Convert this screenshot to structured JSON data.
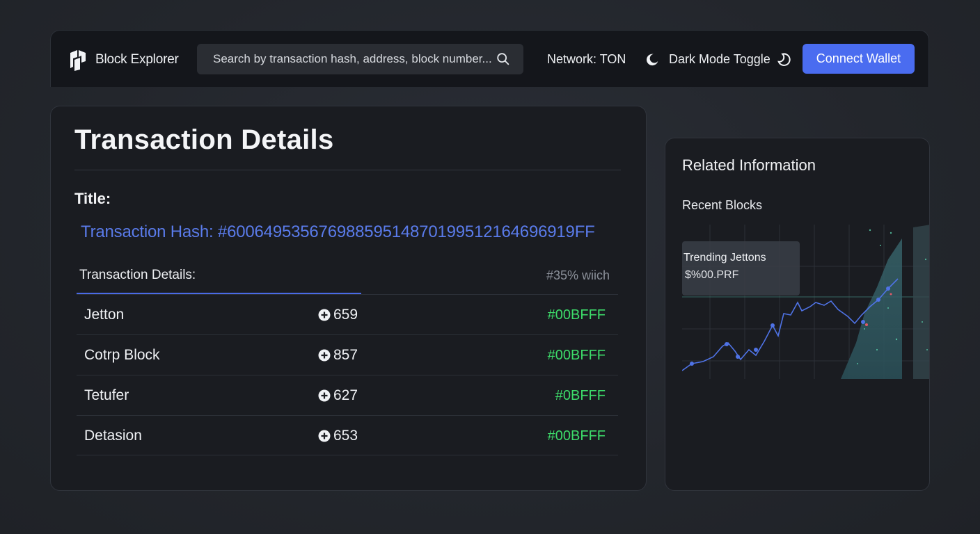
{
  "header": {
    "app_title": "Block Explorer",
    "search_placeholder": "Search by transaction hash, address, block number...",
    "network_label": "Network: TON",
    "dark_mode_label": "Dark Mode Toggle",
    "connect_label": "Connect Wallet"
  },
  "main": {
    "title": "Transaction Details",
    "field_label": "Title:",
    "tx_hash": "Transaction Hash: #600649535676988595148701995121646969​19FF",
    "details_label": "Transaction Details:",
    "details_meta": "#35% wiich",
    "rows": [
      {
        "name": "Jetton",
        "value": "659",
        "color": "#00BFFF"
      },
      {
        "name": "Cotrp Block",
        "value": "857",
        "color": "#00BFFF"
      },
      {
        "name": "Tetufer",
        "value": "627",
        "color": "#0BFFF"
      },
      {
        "name": "Detasion",
        "value": "653",
        "color": "#00BFFF"
      }
    ]
  },
  "side": {
    "title": "Related Information",
    "subtitle": "Recent Blocks",
    "trend_label": "Trending Jettons",
    "trend_value": "$%00.PRF"
  },
  "colors": {
    "accent": "#4a6cf0",
    "hash_blue": "#5a7bea",
    "positive_green": "#3ddc6a",
    "card_bg": "#1a1c21"
  }
}
